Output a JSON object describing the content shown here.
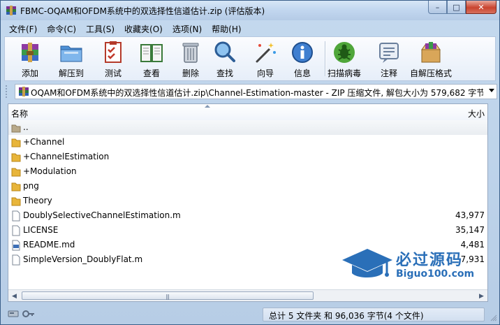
{
  "window": {
    "title": "FBMC-OQAM和OFDM系统中的双选择性信道估计.zip (评估版本)",
    "caption": {
      "minimize": "–",
      "maximize": "□",
      "close": "✕"
    }
  },
  "menu": [
    "文件(F)",
    "命令(C)",
    "工具(S)",
    "收藏夹(O)",
    "选项(N)",
    "帮助(H)"
  ],
  "toolbar": {
    "buttons": [
      {
        "label": "添加",
        "icon": "add-archive-icon"
      },
      {
        "label": "解压到",
        "icon": "extract-to-icon"
      },
      {
        "label": "测试",
        "icon": "test-icon"
      },
      {
        "label": "查看",
        "icon": "view-book-icon"
      },
      {
        "label": "删除",
        "icon": "trash-icon"
      },
      {
        "label": "查找",
        "icon": "find-magnifier-icon"
      },
      {
        "label": "向导",
        "icon": "wizard-wand-icon"
      },
      {
        "label": "信息",
        "icon": "info-icon"
      },
      {
        "label": "扫描病毒",
        "icon": "virus-scan-icon"
      },
      {
        "label": "注释",
        "icon": "comment-icon"
      },
      {
        "label": "自解压格式",
        "icon": "sfx-box-icon"
      }
    ]
  },
  "address": {
    "path": "OQAM和OFDM系统中的双选择性信道估计.zip\\Channel-Estimation-master - ZIP 压缩文件, 解包大小为 579,682 字节"
  },
  "list": {
    "columns": {
      "name": "名称",
      "size": "大小"
    },
    "rows": [
      {
        "name": "..",
        "size": "",
        "type": "parent"
      },
      {
        "name": "+Channel",
        "size": "",
        "type": "folder"
      },
      {
        "name": "+ChannelEstimation",
        "size": "",
        "type": "folder"
      },
      {
        "name": "+Modulation",
        "size": "",
        "type": "folder"
      },
      {
        "name": "png",
        "size": "",
        "type": "folder"
      },
      {
        "name": "Theory",
        "size": "",
        "type": "folder"
      },
      {
        "name": "DoublySelectiveChannelEstimation.m",
        "size": "43,977",
        "type": "file"
      },
      {
        "name": "LICENSE",
        "size": "35,147",
        "type": "file"
      },
      {
        "name": "README.md",
        "size": "4,481",
        "type": "file"
      },
      {
        "name": "SimpleVersion_DoublyFlat.m",
        "size": "7,931",
        "type": "file"
      }
    ]
  },
  "status": {
    "summary": "总计 5 文件夹 和 96,036 字节(4 个文件)"
  },
  "watermark": {
    "title": "必过源码",
    "url": "Biguo100.com"
  },
  "colors": {
    "folder": "#e8b53a",
    "accent": "#2a6fb8",
    "close": "#c9442f"
  }
}
